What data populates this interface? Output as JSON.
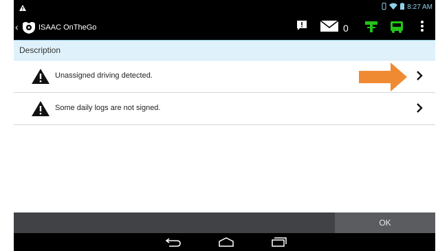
{
  "status_bar": {
    "time": "8:27 AM"
  },
  "app_bar": {
    "title": "ISAAC OnTheGo",
    "message_count": "0"
  },
  "table": {
    "header": "Description",
    "rows": [
      {
        "label": "Unassigned driving detected."
      },
      {
        "label": "Some daily logs are not signed."
      }
    ]
  },
  "footer": {
    "ok_label": "OK"
  },
  "colors": {
    "accent_green": "#25c21a",
    "arrow_orange": "#f08a32",
    "header_bg": "#dff2fb"
  },
  "icons": [
    "alert-icon",
    "mail-icon",
    "signpost-icon",
    "truck-icon",
    "overflow-menu-icon",
    "warning-icon",
    "chevron-right-icon",
    "back-icon",
    "home-icon",
    "recents-icon"
  ]
}
